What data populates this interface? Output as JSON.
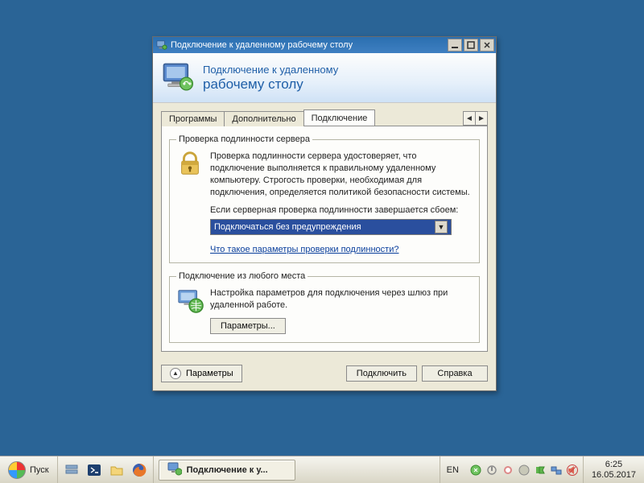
{
  "titlebar": {
    "text": "Подключение к удаленному рабочему столу"
  },
  "banner": {
    "line1": "Подключение к удаленному",
    "line2": "рабочему столу"
  },
  "tabs": {
    "items": [
      "Программы",
      "Дополнительно",
      "Подключение"
    ],
    "active_index": 2
  },
  "group_auth": {
    "legend": "Проверка подлинности сервера",
    "desc": "Проверка подлинности сервера удостоверяет, что подключение выполняется к правильному удаленному компьютеру. Строгость проверки, необходимая для подключения, определяется политикой безопасности системы.",
    "fail_label": "Если серверная проверка подлинности завершается сбоем:",
    "dropdown_value": "Подключаться без предупреждения",
    "help_link": "Что такое параметры проверки подлинности?"
  },
  "group_anywhere": {
    "legend": "Подключение из любого места",
    "desc": "Настройка параметров для подключения через шлюз при удаленной работе.",
    "params_button": "Параметры..."
  },
  "footer": {
    "options_toggle": "Параметры",
    "connect": "Подключить",
    "help": "Справка"
  },
  "taskbar": {
    "start": "Пуск",
    "task_button": "Подключение к у...",
    "lang": "EN",
    "clock_time": "6:25",
    "clock_date": "16.05.2017"
  }
}
